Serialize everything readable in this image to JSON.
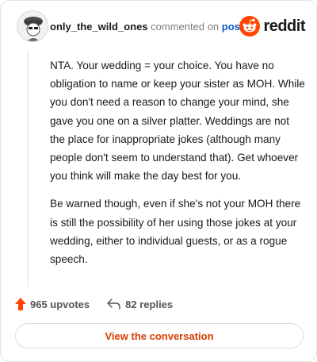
{
  "header": {
    "username": "only_the_wild_ones",
    "action_text": "commented on",
    "post_link": "post",
    "brand": "reddit"
  },
  "comment": {
    "paragraphs": [
      "NTA. Your wedding = your choice. You have no obligation to name or keep your sister as MOH. While you don't need a reason to change your mind, she gave you one on a silver platter. Weddings are not the place for inappropriate jokes (although many people don't seem to understand that). Get whoever you think will make the day best for you.",
      "Be warned though, even if she's not your MOH there is still the possibility of her using those jokes at your wedding, either to individual guests, or as a rogue speech."
    ]
  },
  "actions": {
    "upvotes": "965 upvotes",
    "replies": "82 replies"
  },
  "cta": {
    "label": "View the conversation"
  },
  "colors": {
    "accent": "#ff4500",
    "link": "#0a58d0",
    "cta_text": "#d93a00"
  },
  "icons": [
    "avatar-image",
    "reddit-logo-icon",
    "upvote-arrow-icon",
    "reply-arrow-icon"
  ]
}
